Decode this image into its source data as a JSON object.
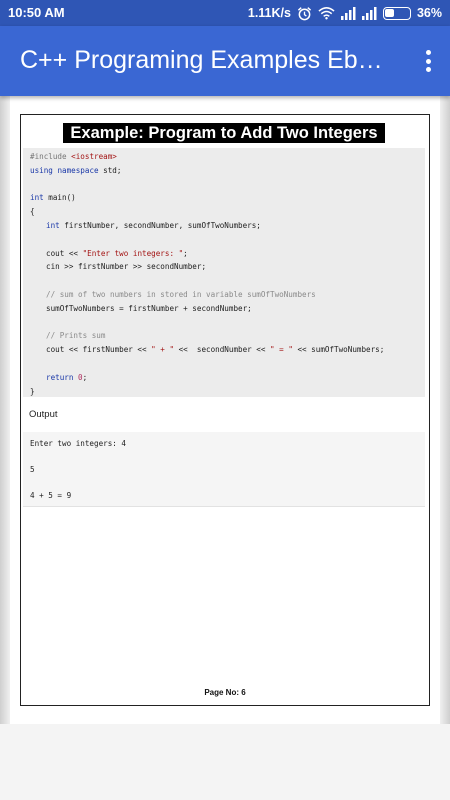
{
  "status_bar": {
    "time": "10:50 AM",
    "network_speed": "1.11K/s",
    "battery_percent": "36%",
    "icons": [
      "alarm-icon",
      "wifi-icon",
      "signal-icon",
      "signal-icon",
      "battery-icon"
    ]
  },
  "app_bar": {
    "title": "C++ Programing Examples Ebook",
    "menu_icon": "more-vert-icon",
    "background_color": "#3a67d3"
  },
  "page": {
    "heading": "Example: Program to Add Two Integers",
    "code": {
      "include": "#include ",
      "iostream": "<iostream>",
      "using": "using",
      "namespace": "namespace",
      "std": " std;",
      "int_main_type": "int",
      "int_main_rest": " main()",
      "open_brace": "{",
      "decl_type": "int",
      "decl_rest": " firstNumber, secondNumber, sumOfTwoNumbers;",
      "cout_prompt_start": "cout << ",
      "cout_prompt_str": "\"Enter two integers: \"",
      "cout_prompt_end": ";",
      "cin_line": "cin >> firstNumber >> secondNumber;",
      "comment_sum": "// sum of two numbers in stored in variable sumOfTwoNumbers",
      "sum_line": "sumOfTwoNumbers = firstNumber + secondNumber;",
      "comment_prints": "// Prints sum",
      "cout_result_1": "cout << firstNumber << ",
      "cout_result_plus": "\" + \"",
      "cout_result_2": " <<  secondNumber << ",
      "cout_result_eq": "\" = \"",
      "cout_result_3": " << sumOfTwoNumbers;",
      "return_kw": "return",
      "return_num": "0",
      "return_end": ";",
      "close_brace": "}"
    },
    "output_label": "Output",
    "output_lines": [
      "Enter two integers: 4",
      "5",
      "4 + 5 = 9"
    ],
    "page_number": "Page No: 6"
  }
}
